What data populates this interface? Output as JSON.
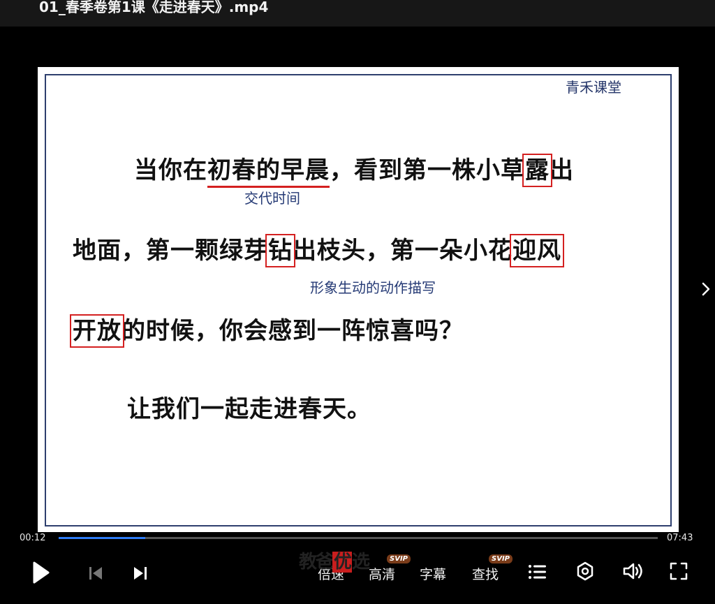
{
  "window": {
    "title": "01_春季卷第1课《走进春天》.mp4"
  },
  "slide": {
    "brand": "青禾课堂",
    "line1": {
      "pre": "当你在",
      "underlined": "初春的早晨",
      "mid": "，看到第一株小草",
      "boxed": "露",
      "post": "出"
    },
    "line2": {
      "pre": "地面，第一颗绿芽",
      "boxed1": "钻",
      "mid": "出枝头，第一朵小花",
      "boxed2": "迎风"
    },
    "line3": {
      "boxed": "开放",
      "post": "的时候，你会感到一阵惊喜吗？"
    },
    "line4": "让我们一起走进春天。",
    "annotation_time": "交代时间",
    "annotation_action": "形象生动的动作描写"
  },
  "player": {
    "current_time": "00:12",
    "total_time": "07:43",
    "progress_fraction": 0.145,
    "speed_label": "倍速",
    "quality_label": "高清",
    "subtitle_label": "字幕",
    "search_label": "查找",
    "svip_badge": "SVIP",
    "accent_color": "#2e7cf6"
  },
  "watermark": {
    "left": "教爸",
    "mid": "优",
    "right": "选"
  },
  "icons": {
    "play": "play-icon",
    "prev": "skip-previous-icon",
    "next": "skip-next-icon",
    "playlist": "playlist-icon",
    "settings": "settings-icon",
    "volume": "volume-icon",
    "fullscreen": "fullscreen-icon",
    "side_next": "chevron-right-icon"
  }
}
